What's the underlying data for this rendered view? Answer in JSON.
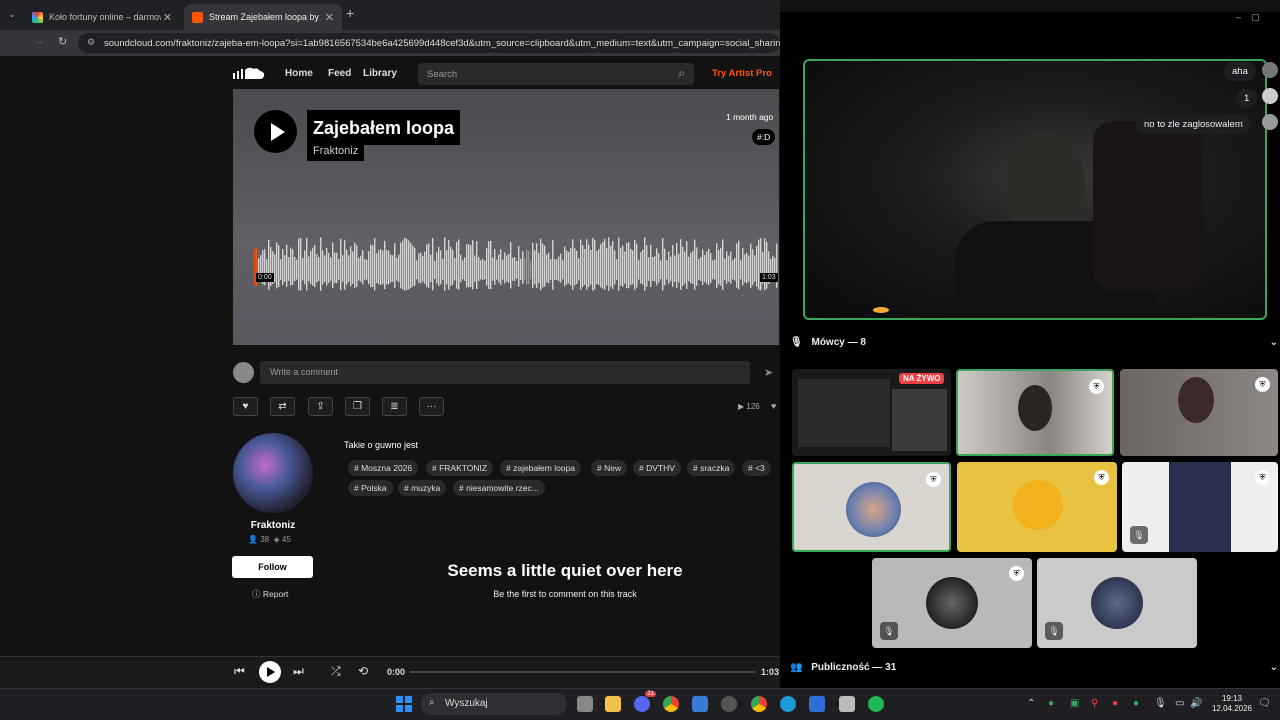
{
  "browser": {
    "tabs": [
      {
        "title": "Koło fortuny online – darmowe",
        "active": false
      },
      {
        "title": "Stream Zajebałem loopa by Fra",
        "active": true
      }
    ],
    "new_tab": "+",
    "url": "soundcloud.com/fraktoniz/zajeba-em-loopa?si=1ab9816567534be6a425699d448cef3d&utm_source=clipboard&utm_medium=text&utm_campaign=social_sharing"
  },
  "soundcloud": {
    "nav": {
      "home": "Home",
      "feed": "Feed",
      "library": "Library",
      "search_placeholder": "Search",
      "try_pro": "Try Artist Pro"
    },
    "track": {
      "title": "Zajebałem loopa",
      "artist": "Fraktoniz",
      "posted": "1 month ago",
      "genre_tag": "#:D",
      "time_start": "0:00",
      "duration": "1:03",
      "play_count": "126"
    },
    "comment_placeholder": "Write a comment",
    "artist_panel": {
      "name": "Fraktoniz",
      "followers": "38",
      "tracks": "45",
      "follow": "Follow",
      "report": "Report"
    },
    "description": "Takie o guwno jest",
    "tags": [
      "Moszna 2026",
      "FRAKTONIZ",
      "zajebałem loopa",
      "New",
      "DVTHV",
      "sraczka",
      "<3",
      "Polska",
      "muzyka",
      "niesamowite rzec..."
    ],
    "empty_title": "Seems a little quiet over here",
    "empty_sub": "Be the first to comment on this track",
    "player": {
      "current": "0:00",
      "total": "1:03"
    }
  },
  "discord": {
    "chat": [
      {
        "text": "aha"
      },
      {
        "text": "1"
      },
      {
        "text": "no to zle zaglosowalem"
      }
    ],
    "speakers_header": "Mówcy — 8",
    "live_badge": "NA ŻYWO",
    "audience_header": "Publiczność — 31",
    "speaker_count": 8
  },
  "taskbar": {
    "search": "Wyszukaj",
    "time": "19:13",
    "date": "12.04.2026",
    "discord_badge": "21"
  },
  "colors": {
    "accent": "#ff5500",
    "discord_green": "#3ba55c",
    "live_red": "#ed4245"
  }
}
